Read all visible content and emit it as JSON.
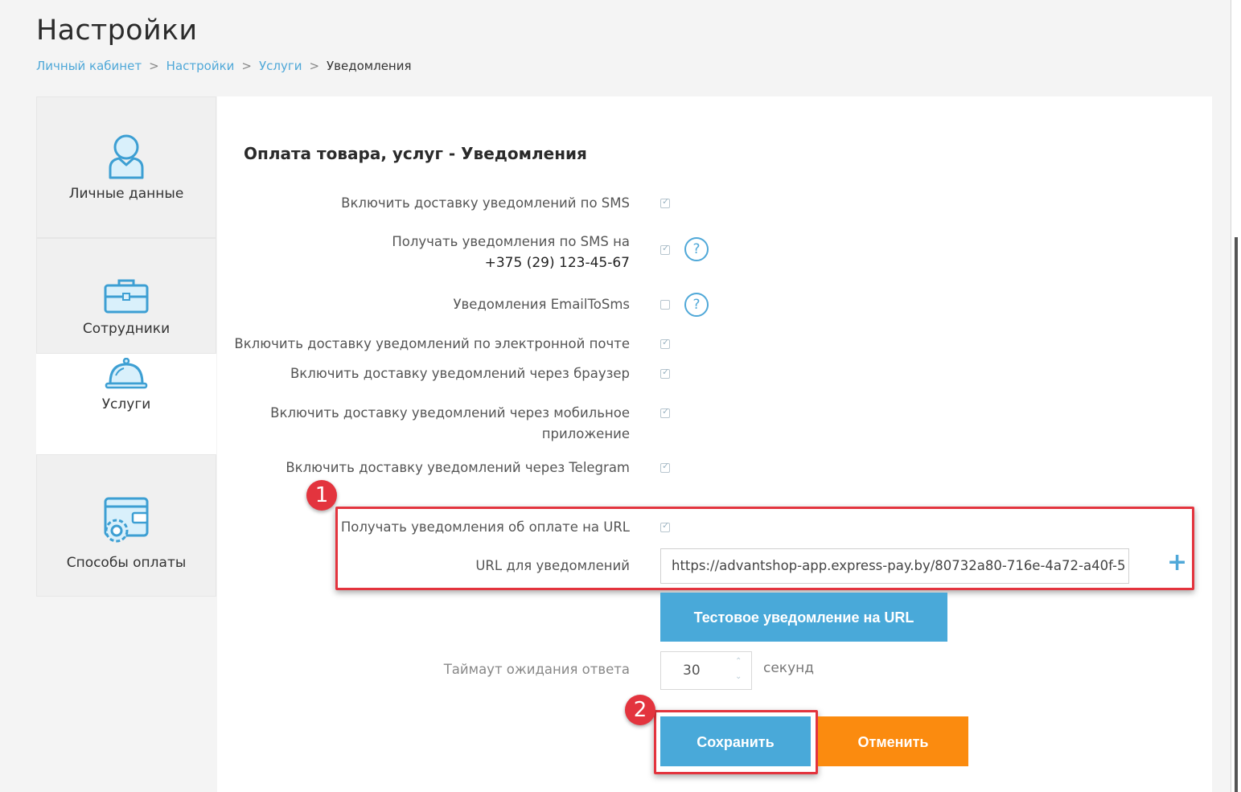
{
  "header": {
    "title": "Настройки",
    "breadcrumb": [
      "Личный кабинет",
      "Настройки",
      "Услуги",
      "Уведомления"
    ],
    "separator": ">"
  },
  "sidebar": {
    "items": [
      {
        "label": "Личные данные",
        "icon": "user-icon",
        "active": false
      },
      {
        "label": "Сотрудники",
        "icon": "briefcase-icon",
        "active": false
      },
      {
        "label": "Услуги",
        "icon": "service-bell-icon",
        "active": true
      },
      {
        "label": "Способы оплаты",
        "icon": "wallet-gear-icon",
        "active": false
      }
    ]
  },
  "main": {
    "section_title": "Оплата товара, услуг - Уведомления",
    "settings": [
      {
        "label": "Включить доставку уведомлений по SMS",
        "checked": true
      },
      {
        "label": "Получать уведомления по SMS на",
        "phone": "+375 (29) 123-45-67",
        "checked": true,
        "help": "?"
      },
      {
        "label": "Уведомления EmailToSms",
        "checked": false,
        "help": "?"
      },
      {
        "label": "Включить доставку уведомлений по электронной почте",
        "checked": true
      },
      {
        "label": "Включить доставку уведомлений через браузер",
        "checked": true
      },
      {
        "label_line1": "Включить доставку уведомлений через мобильное",
        "label_line2": "приложение",
        "checked": true
      },
      {
        "label": "Включить доставку уведомлений через Telegram",
        "checked": true
      },
      {
        "label": "Получать уведомления об оплате на URL",
        "checked": true
      }
    ],
    "url_label": "URL для уведомлений",
    "url_value": "https://advantshop-app.express-pay.by/80732a80-716e-4a72-a40f-5",
    "add_symbol": "+",
    "test_button": "Тестовое уведомление на URL",
    "timeout_label": "Таймаут ожидания ответа",
    "timeout_value": "30",
    "timeout_unit": "секунд",
    "save_button": "Сохранить",
    "cancel_button": "Отменить"
  },
  "annotations": {
    "badge_1": "1",
    "badge_2": "2"
  },
  "colors": {
    "accent": "#49a9d9",
    "link": "#4fa8d8",
    "cancel": "#fb8b0f",
    "highlight": "#e3343e"
  }
}
